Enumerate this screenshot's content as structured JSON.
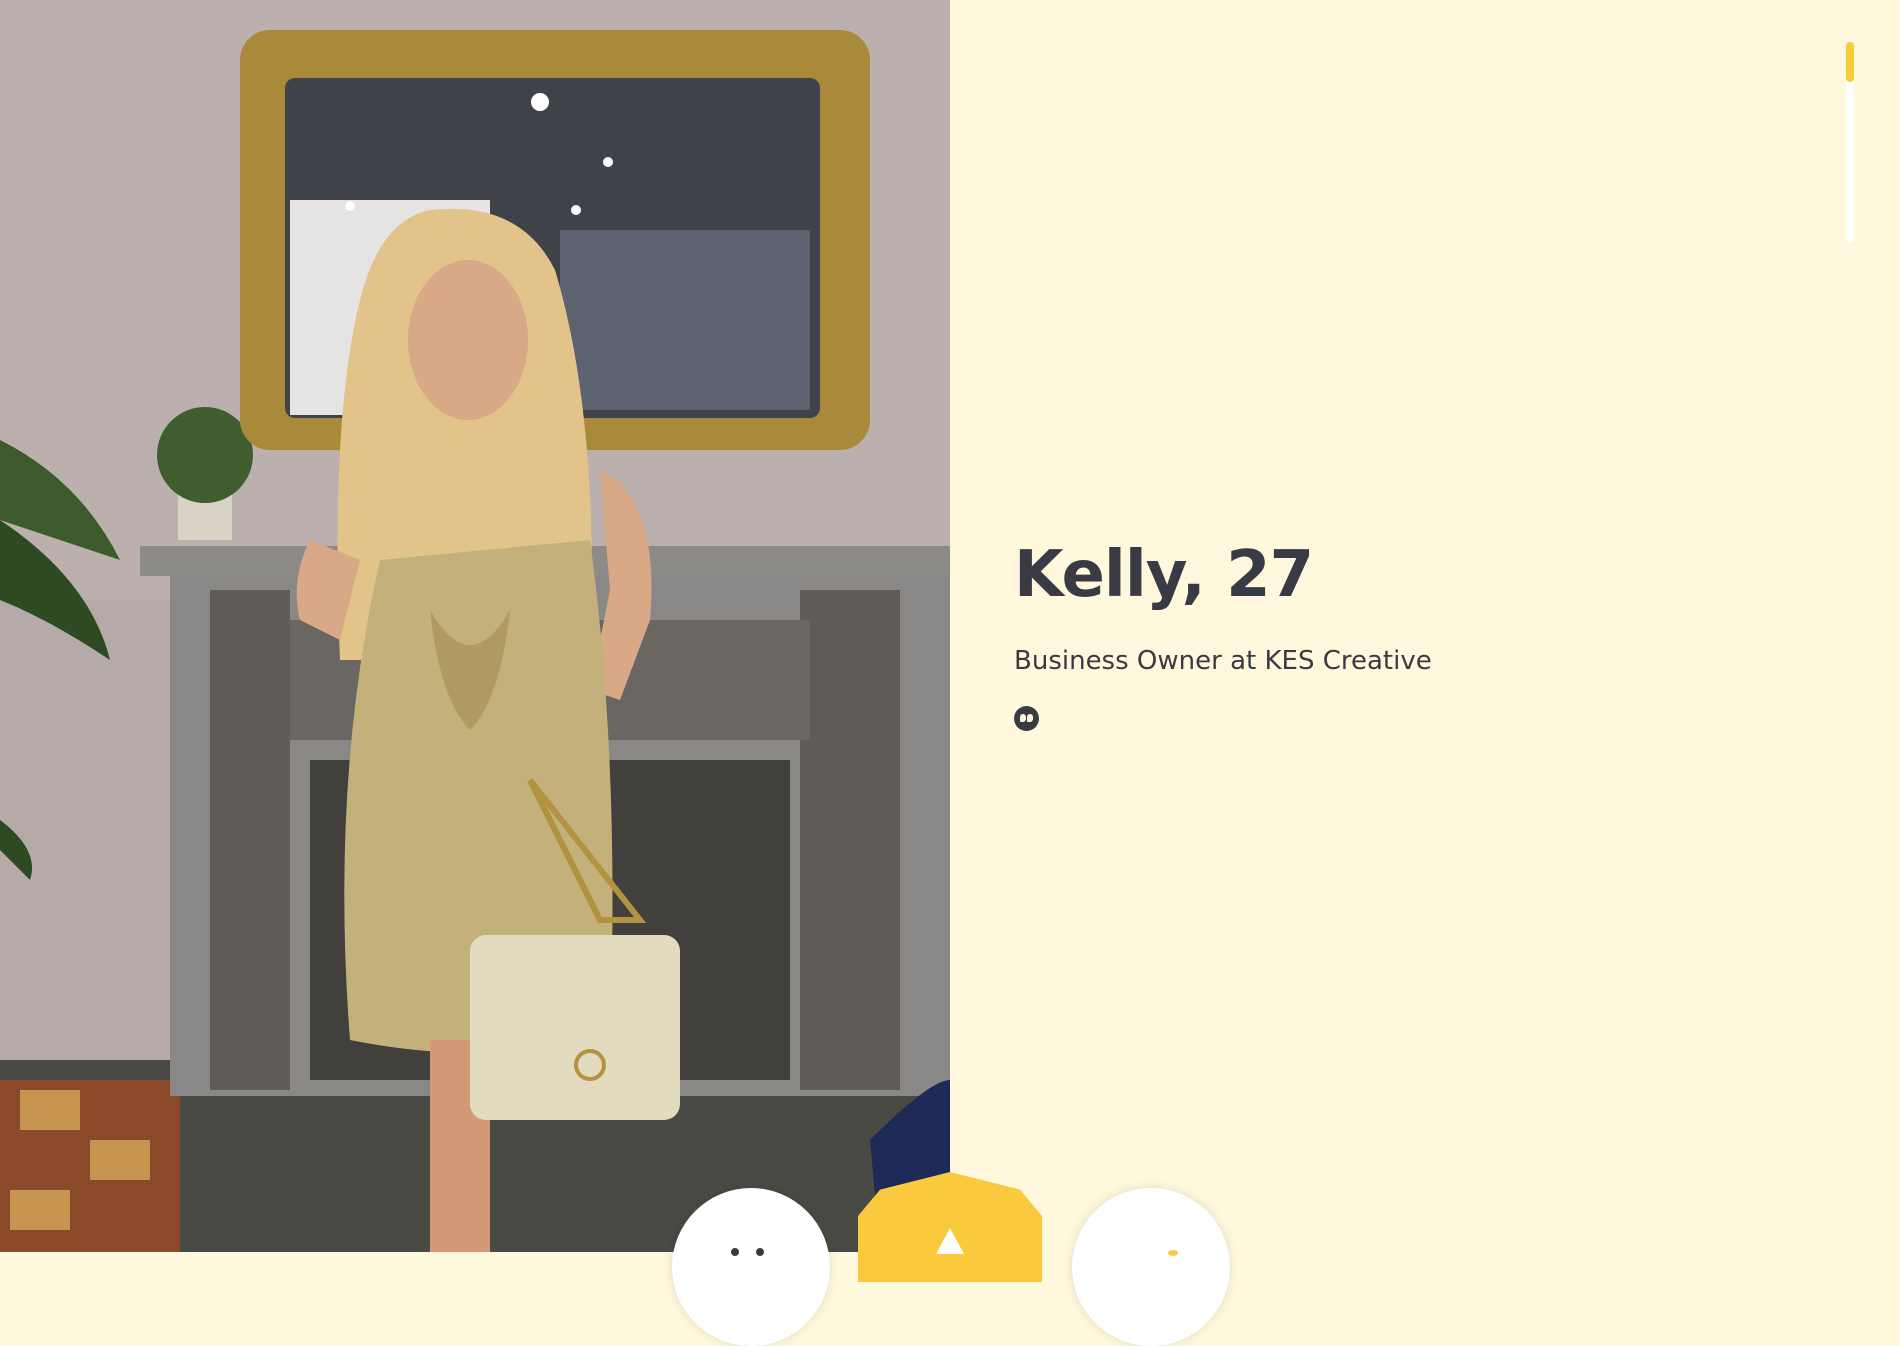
{
  "profile": {
    "name_age": "Kelly, 27",
    "job": "Business Owner at KES Creative"
  },
  "photo": {
    "description_icon": "profile-photo"
  },
  "actions": {
    "pass_icon": "close-icon",
    "superswipe_icon": "superswipe-icon",
    "like_icon": "check-icon"
  },
  "colors": {
    "background": "#fff8dd",
    "accent": "#fbc93d",
    "text": "#3a3a45"
  }
}
